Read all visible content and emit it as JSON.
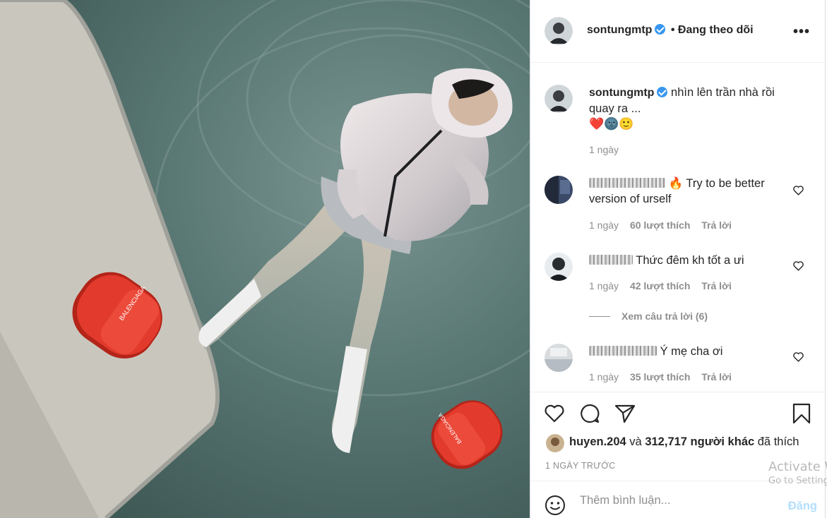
{
  "post": {
    "username": "sontungmtp",
    "follow_status": "• Đang theo dõi",
    "more_icon": "more-options-icon"
  },
  "caption": {
    "username": "sontungmtp",
    "text": "nhìn lên trần nhà rồi quay ra ...",
    "emojis": "❤️🌚🙂",
    "time": "1 ngày"
  },
  "comments": [
    {
      "username": "",
      "text": "🔥 Try to be better version of urself",
      "time": "1 ngày",
      "likes": "60 lượt thích",
      "reply": "Trả lời"
    },
    {
      "username": "",
      "text": " Thức đêm kh tốt a ưi",
      "time": "1 ngày",
      "likes": "42 lượt thích",
      "reply": "Trả lời"
    },
    {
      "username": "",
      "text": " Ý mẹ cha ơi",
      "time": "1 ngày",
      "likes": "35 lượt thích",
      "reply": "Trả lời"
    }
  ],
  "view_replies": "Xem câu trả lời (6)",
  "likes": {
    "liker": "huyen.204",
    "connector": " và ",
    "others": "312,717 người khác",
    "suffix": " đã thích"
  },
  "posted_time": "1 NGÀY TRƯỚC",
  "add_comment": {
    "placeholder": "Thêm bình luận...",
    "post_label": "Đăng"
  },
  "os_watermark": {
    "line1": "Activate Windows",
    "line2": "Go to Settings to activate Windows."
  },
  "colors": {
    "verified": "#3897f0",
    "secondary_text": "#8e8e8e",
    "post_button_disabled": "#b2dffc",
    "slide_red": "#e23a2c"
  }
}
